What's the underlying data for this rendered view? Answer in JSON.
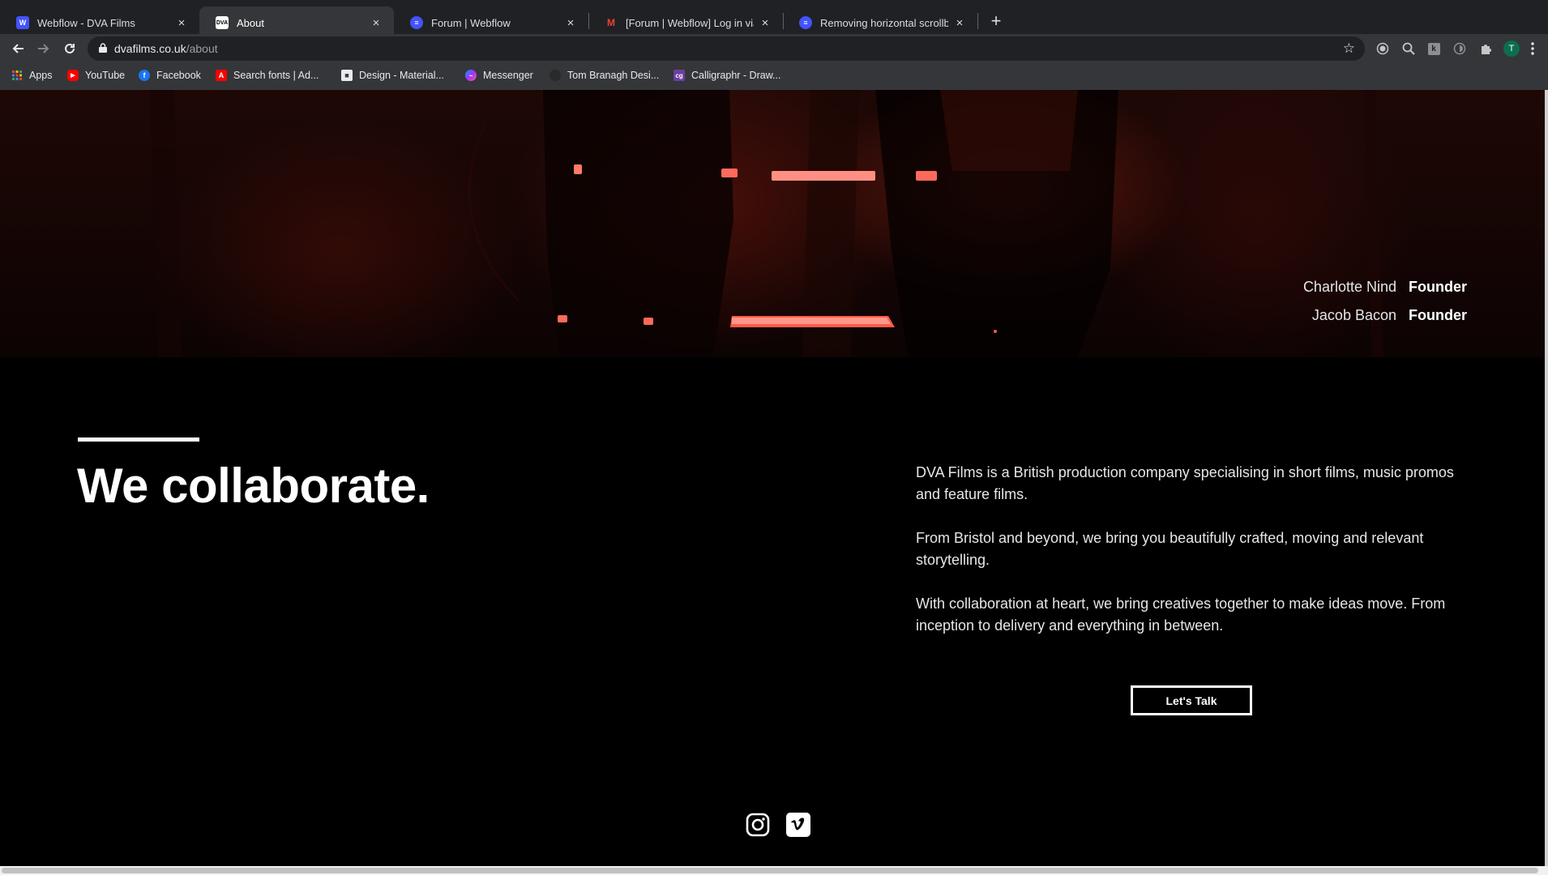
{
  "browser": {
    "tabs": [
      {
        "title": "Webflow - DVA Films",
        "favicon": "W",
        "active": false
      },
      {
        "title": "About",
        "favicon": "DVA",
        "active": true
      },
      {
        "title": "Forum | Webflow",
        "favicon": "forum",
        "active": false
      },
      {
        "title": "[Forum | Webflow] Log in via li",
        "favicon": "M",
        "active": false
      },
      {
        "title": "Removing horizontal scrollbar",
        "favicon": "forum",
        "active": false
      }
    ],
    "url_host": "dvafilms.co.uk",
    "url_path": "/about",
    "profile_initial": "T",
    "bookmarks": [
      {
        "label": "Apps",
        "icon": "apps-grid-icon"
      },
      {
        "label": "YouTube",
        "icon": "youtube-icon"
      },
      {
        "label": "Facebook",
        "icon": "facebook-icon"
      },
      {
        "label": "Search fonts | Ad...",
        "icon": "adobe-icon"
      },
      {
        "label": "Design - Material...",
        "icon": "material-icon"
      },
      {
        "label": "Messenger",
        "icon": "messenger-icon"
      },
      {
        "label": "Tom Branagh Desi...",
        "icon": "site-icon"
      },
      {
        "label": "Calligraphr - Draw...",
        "icon": "calligraphr-icon"
      }
    ]
  },
  "hero": {
    "team": [
      {
        "name": "Charlotte Nind",
        "role": "Founder"
      },
      {
        "name": "Jacob Bacon",
        "role": "Founder"
      }
    ]
  },
  "about": {
    "headline": "We collaborate.",
    "paragraphs": [
      "DVA Films is a British production company specialising in short films, music promos and feature films.",
      "From Bristol and beyond, we bring you beautifully crafted, moving and relevant storytelling.",
      "With collaboration at heart, we bring creatives together to make ideas move. From inception to delivery and everything in between."
    ],
    "cta_label": "Let's Talk"
  },
  "footer": {
    "social": [
      "instagram-icon",
      "vimeo-icon"
    ]
  }
}
